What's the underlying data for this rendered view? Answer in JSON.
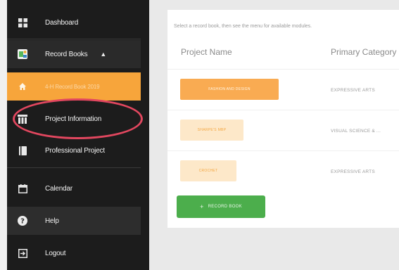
{
  "sidebar": {
    "items": [
      {
        "label": "Dashboard",
        "icon": "grid-icon"
      },
      {
        "label": "Record Books",
        "icon": "record-books-icon"
      },
      {
        "label": "4-H Record Book 2019",
        "icon": "home-icon"
      },
      {
        "label": "Project Information",
        "icon": "table-icon"
      },
      {
        "label": "Professional Project",
        "icon": "book-icon"
      },
      {
        "label": "Calendar",
        "icon": "calendar-icon"
      },
      {
        "label": "Help",
        "icon": "question-icon"
      },
      {
        "label": "Logout",
        "icon": "logout-icon"
      }
    ],
    "caret": "▲"
  },
  "main": {
    "instructions": "Select a record book, then see the menu for available modules.",
    "columns": [
      "Project Name",
      "Primary Category"
    ],
    "rows": [
      {
        "project": "FASHION AND DESIGN",
        "category": "EXPRESSIVE ARTS"
      },
      {
        "project": "SHARPE'S MBP",
        "category": "VISUAL SCIENCE & ..."
      },
      {
        "project": "CROCHET",
        "category": "EXPRESSIVE ARTS"
      }
    ],
    "add_button": {
      "label": "RECORD BOOK",
      "plus": "+"
    }
  },
  "colors": {
    "sidebar_bg": "#1c1c1c",
    "active_item": "#f7a53b",
    "add_button": "#4cae4c",
    "highlight": "#e2475f"
  }
}
